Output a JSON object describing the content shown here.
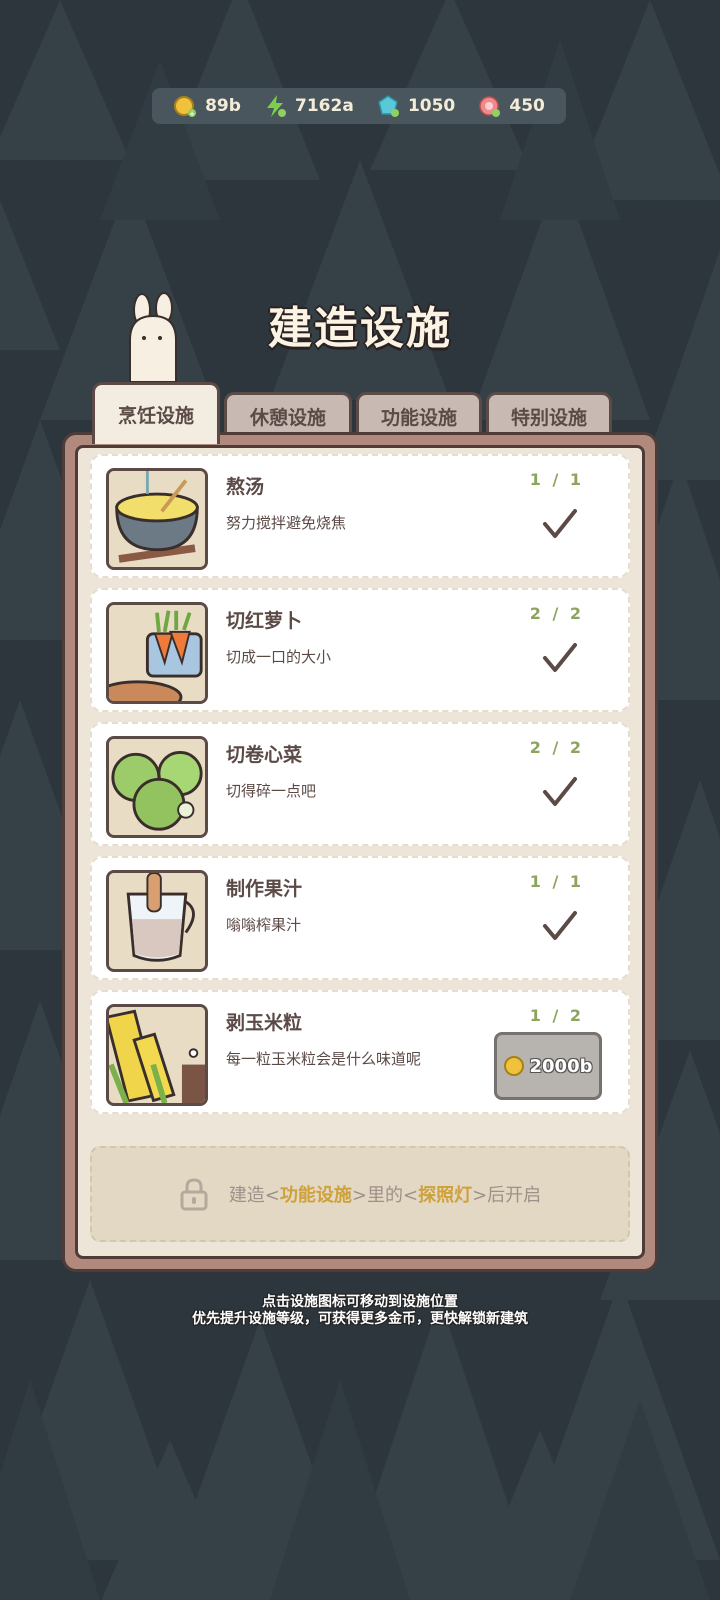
{
  "resources": [
    {
      "icon": "coin-icon",
      "value": "89b"
    },
    {
      "icon": "energy-icon",
      "value": "7162a"
    },
    {
      "icon": "gem-icon",
      "value": "1050"
    },
    {
      "icon": "candy-icon",
      "value": "450"
    }
  ],
  "title": "建造设施",
  "tabs": [
    "烹饪设施",
    "休憩设施",
    "功能设施",
    "特别设施"
  ],
  "active_tab": 0,
  "facilities": [
    {
      "name": "熬汤",
      "desc": "努力搅拌避免烧焦",
      "count": "1 / 1",
      "status": "done",
      "thumb": "soup-pot"
    },
    {
      "name": "切红萝卜",
      "desc": "切成一口的大小",
      "count": "2 / 2",
      "status": "done",
      "thumb": "carrots"
    },
    {
      "name": "切卷心菜",
      "desc": "切得碎一点吧",
      "count": "2 / 2",
      "status": "done",
      "thumb": "cabbage"
    },
    {
      "name": "制作果汁",
      "desc": "嗡嗡榨果汁",
      "count": "1 / 1",
      "status": "done",
      "thumb": "juice"
    },
    {
      "name": "剥玉米粒",
      "desc": "每一粒玉米粒会是什么味道呢",
      "count": "1 / 2",
      "status": "buy",
      "price": "2000b",
      "thumb": "corn"
    }
  ],
  "locked": {
    "prefix": "建造<",
    "facility": "功能设施",
    "mid1": ">里的<",
    "item": "探照灯",
    "suffix": ">后开启"
  },
  "hints": [
    "点击设施图标可移动到设施位置",
    "优先提升设施等级，可获得更多金币，更快解锁新建筑"
  ],
  "colors": {
    "count_done": "#8da45e",
    "count_partial": "#8da45e",
    "highlight": "#cfa13a",
    "panel_border": "#4e3c39"
  }
}
